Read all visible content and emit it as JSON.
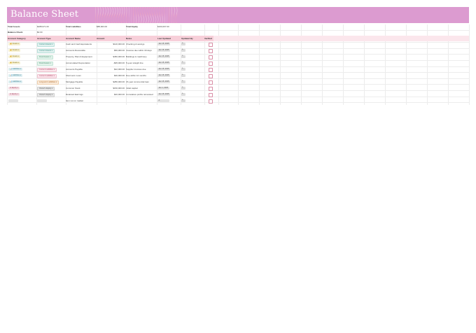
{
  "title": "Balance Sheet",
  "summary": {
    "total_assets_label": "Total Assets",
    "total_assets_value": "$488,971.00",
    "total_liabilities_label": "Total Liabilities",
    "total_liabilities_value": "$88,903.00",
    "total_equity_label": "Total Equity",
    "total_equity_value": "$100,067.00",
    "balance_check_label": "Balance Check",
    "balance_check_value": "$0.00"
  },
  "columns": [
    "Account Category",
    "Account Type",
    "Account Name",
    "Amount",
    "Notes",
    "Last Updated",
    "Updated By",
    "Verified"
  ],
  "rows": [
    {
      "category": "Assets",
      "cat_icon": "money-bag-icon",
      "type": "Current Assets",
      "name": "Cash and Cash Equivalents",
      "amount": "$120,000.00",
      "notes": "Checking & savings",
      "updated": "Jan 15, 2025",
      "by": "A"
    },
    {
      "category": "Assets",
      "cat_icon": "money-bag-icon",
      "type": "Current Assets",
      "name": "Accounts Receivable",
      "amount": "$56,000.00",
      "notes": "Invoices due within 30 days",
      "updated": "Jan 15, 2025",
      "by": "A"
    },
    {
      "category": "Assets",
      "cat_icon": "money-bag-icon",
      "type": "Fixed Assets",
      "name": "Property, Plant & Equipment",
      "amount": "$450,000.00",
      "notes": "Buildings & machinery",
      "updated": "Jan 15, 2025",
      "by": "A"
    },
    {
      "category": "Assets",
      "cat_icon": "money-bag-icon",
      "type": "Fixed Assets",
      "name": "Accumulated Depreciation",
      "amount": "-$95,000.00",
      "notes": "5-year straight line",
      "updated": "Jan 15, 2025",
      "by": "A"
    },
    {
      "category": "Liabilities",
      "cat_icon": "chart-icon",
      "type": "Current Liabilities",
      "name": "Accounts Payable",
      "amount": "$42,000.00",
      "notes": "Supplier invoices due",
      "updated": "Jan 15, 2025",
      "by": "A"
    },
    {
      "category": "Liabilities",
      "cat_icon": "chart-icon",
      "type": "Current Liabilities",
      "name": "Short-term Loan",
      "amount": "$30,000.00",
      "notes": "Due within 12 months",
      "updated": "Jan 15, 2025",
      "by": "A"
    },
    {
      "category": "Liabilities",
      "cat_icon": "chart-icon",
      "type": "Long-term Liabilities",
      "name": "Mortgage Payable",
      "amount": "$280,000.00",
      "notes": "15-year commercial loan",
      "updated": "Jan 15, 2025",
      "by": "A"
    },
    {
      "category": "Equity",
      "cat_icon": "scale-icon",
      "type": "Owner's Equity",
      "name": "Common Stock",
      "amount": "$150,000.00",
      "notes": "Initial capital",
      "updated": "Jan 1, 2025",
      "by": "A"
    },
    {
      "category": "Equity",
      "cat_icon": "scale-icon",
      "type": "Owner's Equity",
      "name": "Retained Earnings",
      "amount": "$40,000.00",
      "notes": "Cumulative profits reinvested",
      "updated": "Jan 15, 2025",
      "by": "A"
    },
    {
      "category": "",
      "cat_icon": "",
      "type": "",
      "name": "Item not on market",
      "amount": "",
      "notes": "",
      "updated": "A",
      "by": "A"
    }
  ]
}
